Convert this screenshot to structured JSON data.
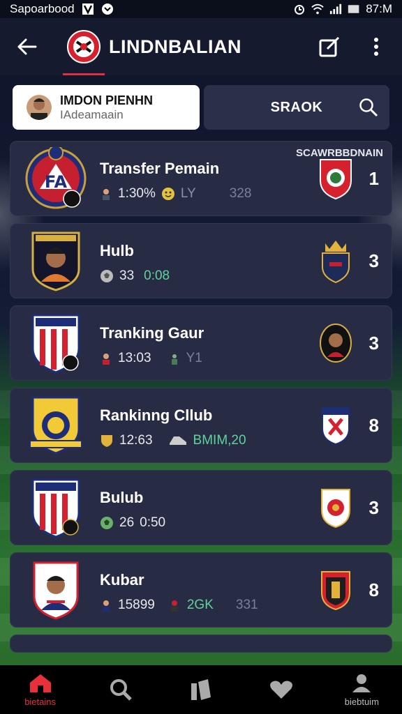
{
  "status_bar": {
    "carrier": "Sapoarbood",
    "time": "87:M"
  },
  "app_bar": {
    "title": "LINDNBALIAN"
  },
  "profile": {
    "name": "IMDON PIENHN",
    "subtitle": "IAdeamaain"
  },
  "search": {
    "label": "SRAOK"
  },
  "list": {
    "header": "SCAWRBBDNAIN",
    "rows": [
      {
        "title": "Transfer Pemain",
        "stat1": "1:30%",
        "stat2": "LY",
        "stat3": "328",
        "rank": "1"
      },
      {
        "title": "Hulb",
        "stat1": "33",
        "stat2": "0:08",
        "stat3": "",
        "rank": "3"
      },
      {
        "title": "Tranking Gaur",
        "stat1": "13:03",
        "stat2": "Y1",
        "stat3": "",
        "rank": "3"
      },
      {
        "title": "Rankinng Cllub",
        "stat1": "12:63",
        "stat2": "BMIM,20",
        "stat3": "",
        "rank": "8"
      },
      {
        "title": "Bulub",
        "stat1": "26",
        "stat2": "0:50",
        "stat3": "",
        "rank": "3"
      },
      {
        "title": "Kubar",
        "stat1": "15899",
        "stat2": "2GK",
        "stat3": "331",
        "rank": "8"
      }
    ]
  },
  "bottom_nav": {
    "home": "bietains",
    "profile": "biebtuim"
  },
  "colors": {
    "accent": "#e8303a",
    "card": "#272c44",
    "appbar": "#151a2e"
  }
}
